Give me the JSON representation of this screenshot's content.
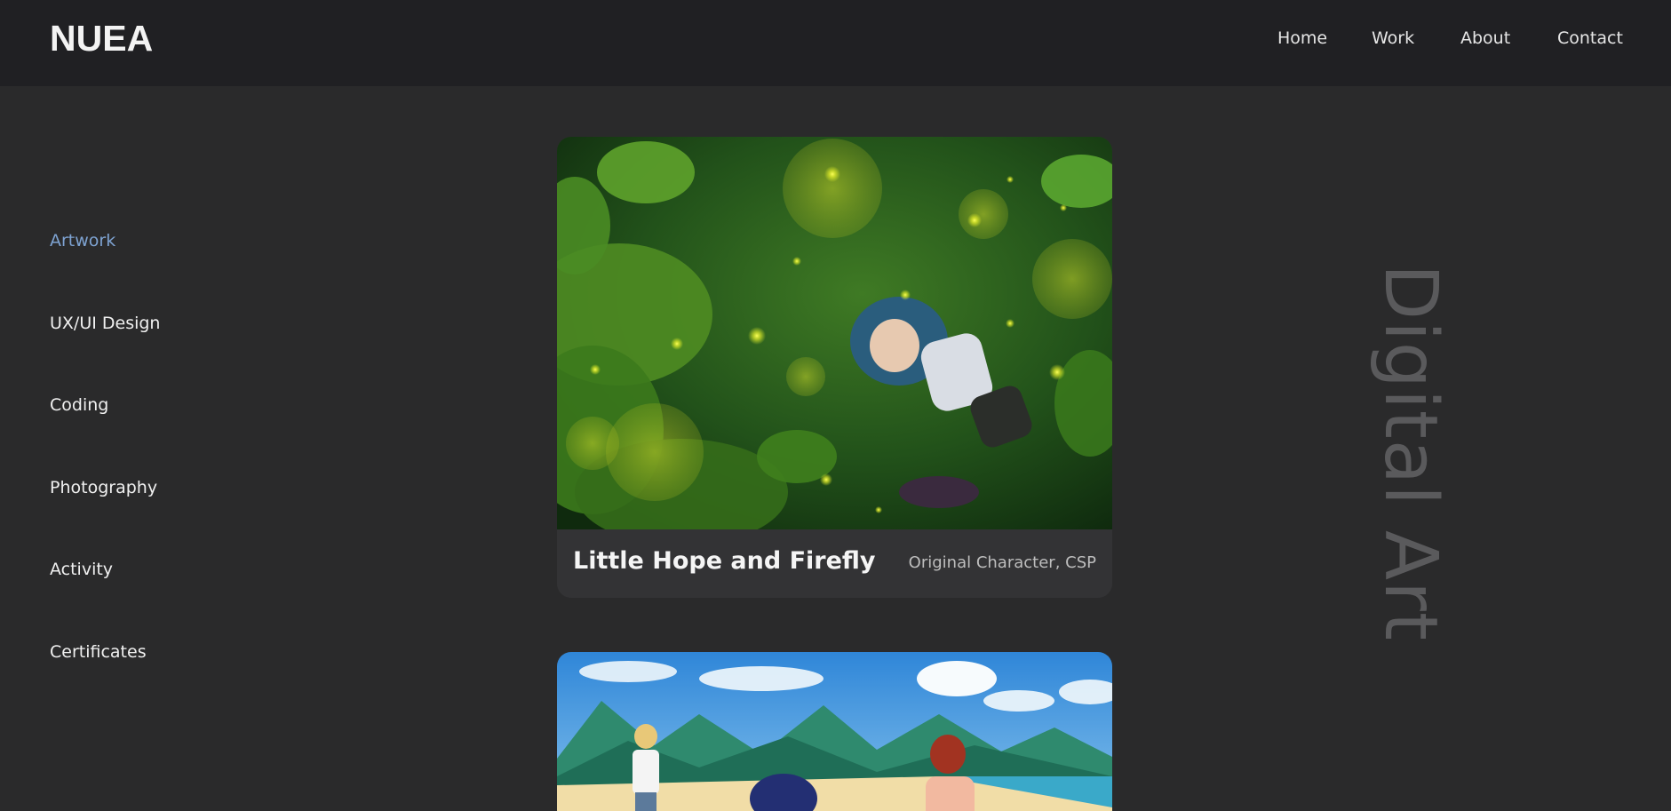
{
  "header": {
    "logo": "NUEA",
    "nav": {
      "home": "Home",
      "work": "Work",
      "about": "About",
      "contact": "Contact"
    }
  },
  "sidebar": {
    "items": [
      {
        "label": "Artwork",
        "active": true
      },
      {
        "label": "UX/UI Design",
        "active": false
      },
      {
        "label": "Coding",
        "active": false
      },
      {
        "label": "Photography",
        "active": false
      },
      {
        "label": "Activity",
        "active": false
      },
      {
        "label": "Certificates",
        "active": false
      }
    ]
  },
  "section": {
    "heading": "Digital Art"
  },
  "cards": [
    {
      "title": "Little Hope and Firefly",
      "meta": "Original Character, CSP"
    },
    {
      "title": "",
      "meta": ""
    }
  ],
  "colors": {
    "background": "#2a2a2b",
    "header": "#202023",
    "accent": "#7ea3d2",
    "card": "#333335"
  }
}
